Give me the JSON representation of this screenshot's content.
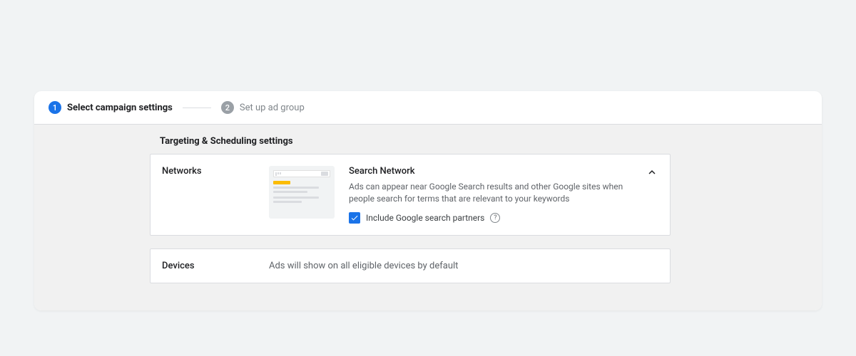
{
  "stepper": {
    "step1": {
      "num": "1",
      "label": "Select campaign settings"
    },
    "step2": {
      "num": "2",
      "label": "Set up ad group"
    }
  },
  "section": {
    "title": "Targeting & Scheduling settings"
  },
  "networks": {
    "label": "Networks",
    "title": "Search Network",
    "description": "Ads can appear near Google Search results and other Google sites when people search for terms that are relevant to your keywords",
    "checkbox_label": "Include Google search partners"
  },
  "devices": {
    "label": "Devices",
    "description": "Ads will show on all eligible devices by default"
  }
}
